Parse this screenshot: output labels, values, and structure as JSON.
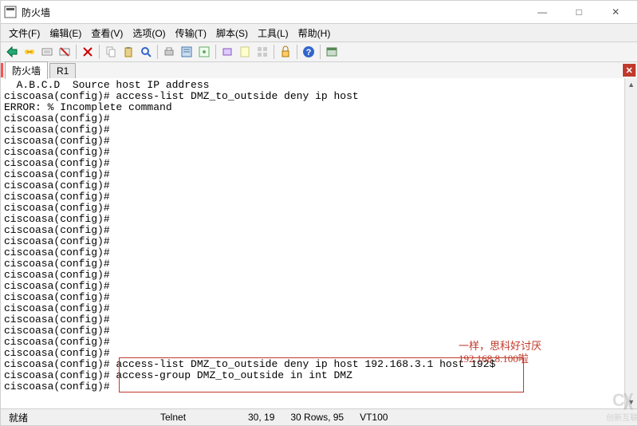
{
  "window": {
    "title": "防火墙",
    "min_label": "—",
    "max_label": "□",
    "close_label": "✕"
  },
  "menu": {
    "file": "文件(F)",
    "edit": "编辑(E)",
    "view": "查看(V)",
    "options": "选项(O)",
    "transfer": "传输(T)",
    "script": "脚本(S)",
    "tools": "工具(L)",
    "help": "帮助(H)"
  },
  "tabs": {
    "tab1": "防火墙",
    "tab2": "R1",
    "close": "✕"
  },
  "terminal": {
    "lines": [
      "  A.B.C.D  Source host IP address",
      "ciscoasa(config)# access-list DMZ_to_outside deny ip host",
      "ERROR: % Incomplete command",
      "ciscoasa(config)#",
      "ciscoasa(config)#",
      "ciscoasa(config)#",
      "ciscoasa(config)#",
      "ciscoasa(config)#",
      "ciscoasa(config)#",
      "ciscoasa(config)#",
      "ciscoasa(config)#",
      "ciscoasa(config)#",
      "ciscoasa(config)#",
      "ciscoasa(config)#",
      "ciscoasa(config)#",
      "ciscoasa(config)#",
      "ciscoasa(config)#",
      "ciscoasa(config)#",
      "ciscoasa(config)#",
      "ciscoasa(config)#",
      "ciscoasa(config)#",
      "ciscoasa(config)#",
      "ciscoasa(config)#",
      "ciscoasa(config)#",
      "ciscoasa(config)#",
      "ciscoasa(config)# access-list DMZ_to_outside deny ip host 192.168.3.1 host 192$",
      "ciscoasa(config)# access-group DMZ_to_outside in int DMZ",
      "ciscoasa(config)#"
    ]
  },
  "annotation": {
    "line1": "一样，思科好讨厌",
    "line2": "192.168.8.100啦"
  },
  "status": {
    "ready": "就绪",
    "protocol": "Telnet",
    "cursor": "30,  19",
    "size": "30 Rows, 95",
    "emu": "VT100"
  },
  "watermark": {
    "logo": "C)(",
    "text": "创新互联"
  }
}
